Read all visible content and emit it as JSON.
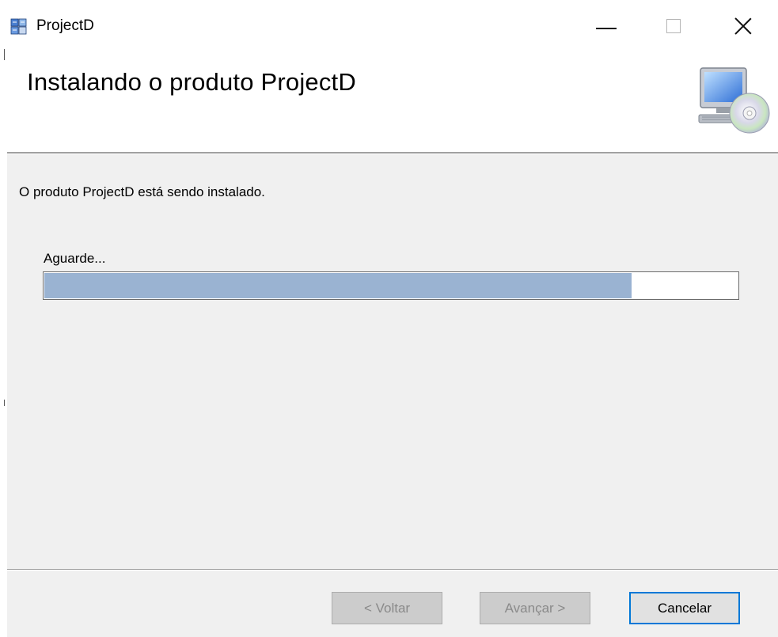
{
  "window": {
    "title": "ProjectD",
    "controls": {
      "minimize": "minimize",
      "maximize": "maximize",
      "close": "close"
    }
  },
  "header": {
    "title": "Instalando o produto ProjectD",
    "icon": "computer-cd-icon"
  },
  "body": {
    "status_text": "O produto ProjectD está sendo instalado.",
    "progress_label": "Aguarde...",
    "progress_fraction": 0.847,
    "progress_color": "#9ab3d2"
  },
  "footer": {
    "back_label": "< Voltar",
    "next_label": "Avançar >",
    "cancel_label": "Cancelar",
    "focus_color": "#0078d7"
  }
}
